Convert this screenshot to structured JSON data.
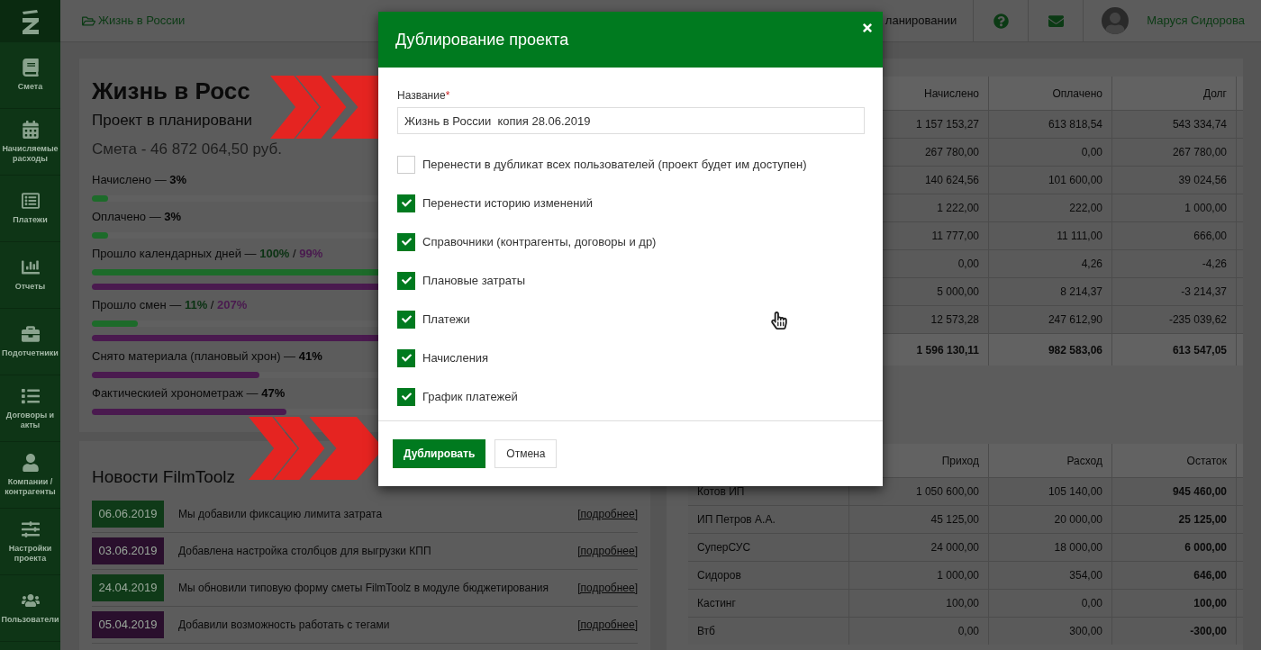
{
  "sidebar": {
    "items": [
      {
        "label": "Смета"
      },
      {
        "label": "Начисляемые расходы"
      },
      {
        "label": "Платежи"
      },
      {
        "label": "Отчеты"
      },
      {
        "label": "Подотчетники"
      },
      {
        "label": "Договоры и акты"
      },
      {
        "label": "Компании / контрагенты"
      },
      {
        "label": "Настройки проекта"
      },
      {
        "label": "Пользователи"
      }
    ]
  },
  "topbar": {
    "breadcrumb": "Жизнь в России",
    "project_status": "ланировании",
    "user": "Маруся Сидорова"
  },
  "project": {
    "title": "Жизнь в Росс",
    "subtitle": "Проект в планировани",
    "estimate": "Смета - 46 872 064,50 руб.",
    "stats": [
      {
        "label": "Начислено — ",
        "values": [
          {
            "text": "3%"
          }
        ],
        "bars": [
          {
            "level": 0.03,
            "color": "#1d6b2a"
          }
        ]
      },
      {
        "label": "Оплачено — ",
        "values": [
          {
            "text": "3%"
          }
        ],
        "bars": [
          {
            "level": 0.03,
            "color": "#1d6b2a"
          }
        ]
      },
      {
        "label": "Прошло календарных дней — ",
        "separator": "/",
        "values": [
          {
            "text": "100%",
            "color": "#0a3212"
          },
          {
            "text": "99%",
            "color": "#4a1a4f"
          }
        ],
        "bars": [
          {
            "level": 1,
            "color": "#1d6b2a"
          },
          {
            "level": 0.99,
            "color": "#4a1a4f"
          }
        ]
      },
      {
        "label": "Прошло смен — ",
        "separator": "/",
        "values": [
          {
            "text": "11%",
            "color": "#0a3212"
          },
          {
            "text": "207%",
            "color": "#4a1a4f"
          }
        ],
        "bars": [
          {
            "level": 0.085,
            "color": "#1d6b2a"
          },
          {
            "level": 1,
            "color": "#4a1a4f"
          }
        ]
      },
      {
        "label": "Снято материала (плановый хрон) — ",
        "values": [
          {
            "text": "41%"
          }
        ],
        "bars": [
          {
            "level": 0.31,
            "color": "#4a1a4f"
          }
        ]
      },
      {
        "label": "Фактическией хронометраж — ",
        "values": [
          {
            "text": "47%"
          }
        ],
        "bars": [
          {
            "level": 0.36,
            "color": "#4a1a4f"
          }
        ]
      }
    ]
  },
  "news": {
    "title": "Новости FilmToolz",
    "items": [
      {
        "date": "06.06.2019",
        "color": "#0f3a18",
        "text": "Мы добавили фиксацию лимита затрата",
        "link": "[подробнее]"
      },
      {
        "date": "03.06.2019",
        "color": "#2a0f2d",
        "text": "Добавлена настройка столбцов для выгрузки КПП",
        "link": "[подробнее]"
      },
      {
        "date": "24.04.2019",
        "color": "#0f3a18",
        "text": "Мы обновили типовую форму сметы FilmToolz в модуле бюджетирования",
        "link": "[подробнее]"
      },
      {
        "date": "05.04.2019",
        "color": "#2a0f2d",
        "text": "Добавили возможность работать с тегами",
        "link": "[подробнее]"
      }
    ]
  },
  "summary_table": {
    "columns": [
      "Начислено",
      "Оплачено",
      "Долг"
    ],
    "rows": [
      [
        "1 157 153,27",
        "613 818,54",
        "543 334,74"
      ],
      [
        "267 780,00",
        "0,00",
        "267 780,00"
      ],
      [
        "140 624,56",
        "101 600,00",
        "39 024,56"
      ],
      [
        "1 222,00",
        "222,00",
        "1 000,00"
      ],
      [
        "11 777,00",
        "11 111,00",
        "666,00"
      ],
      [
        "0,00",
        "4,26",
        "-4,26"
      ],
      [
        "5 000,00",
        "8 214,37",
        "-3 214,37"
      ],
      [
        "12 573,28",
        "247 612,90",
        "-235 039,62"
      ]
    ],
    "total": [
      "1 596 130,11",
      "982 583,06",
      "613 547,05"
    ]
  },
  "balance_table": {
    "columns": [
      "",
      "Приход",
      "Расход",
      "Остаток"
    ],
    "rows": [
      [
        "Котов ИП",
        "1 050 600,00",
        "105 140,00",
        "945 460,00"
      ],
      [
        "ИП Петров А.А.",
        "45 125,00",
        "20 000,00",
        "25 125,00"
      ],
      [
        "СуперСУС",
        "24 000,00",
        "18 000,00",
        "6 000,00"
      ],
      [
        "Сидоров",
        "1 000,00",
        "354,00",
        "646,00"
      ],
      [
        "Кастинг",
        "100,00",
        "0,00",
        "100,00"
      ],
      [
        "Втб",
        "0,00",
        "300,00",
        "-300,00"
      ]
    ]
  },
  "dialog": {
    "title": "Дублирование проекта",
    "field": {
      "label": "Название",
      "required_mark": "*",
      "value": "Жизнь в России  копия 28.06.2019"
    },
    "options": [
      {
        "label": "Перенести в дубликат всех пользователей (проект будет им доступен)",
        "checked": false
      },
      {
        "label": "Перенести историю изменений",
        "checked": true
      },
      {
        "label": "Справочники (контрагенты, договоры и др)",
        "checked": true
      },
      {
        "label": "Плановые затраты",
        "checked": true
      },
      {
        "label": "Платежи",
        "checked": true
      },
      {
        "label": "Начисления",
        "checked": true
      },
      {
        "label": "График платежей",
        "checked": true
      }
    ],
    "buttons": [
      {
        "label": "Дублировать",
        "kind": "primary"
      },
      {
        "label": "Отмена",
        "kind": "secondary"
      }
    ]
  }
}
